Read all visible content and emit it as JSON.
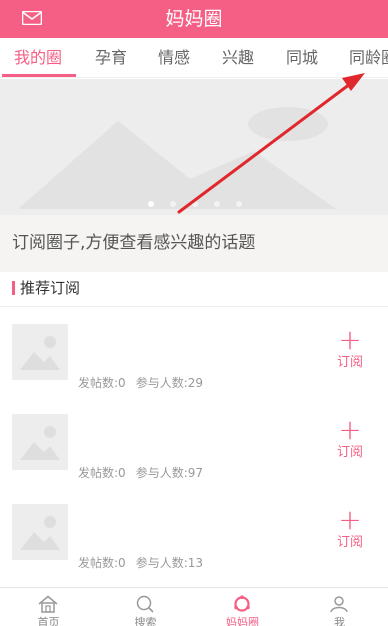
{
  "header": {
    "title": "妈妈圈",
    "mail_icon": "mail-icon",
    "background": "#f55f85"
  },
  "tabs": [
    {
      "label": "我的圈",
      "active": true
    },
    {
      "label": "孕育",
      "active": false
    },
    {
      "label": "情感",
      "active": false
    },
    {
      "label": "兴趣",
      "active": false
    },
    {
      "label": "同城",
      "active": false
    },
    {
      "label": "同龄圈",
      "active": false
    }
  ],
  "banner": {
    "icon": "image-placeholder-icon",
    "page_count": 5,
    "active_index": 0
  },
  "hint": {
    "text": "订阅圈子,方便查看感兴趣的话题"
  },
  "section": {
    "title": "推荐订阅"
  },
  "circles": [
    {
      "thumb_icon": "image-placeholder-icon",
      "posts_label": "发帖数:0",
      "members_label": "参与人数:29",
      "subscribe_label": "订阅",
      "plus": "+"
    },
    {
      "thumb_icon": "image-placeholder-icon",
      "posts_label": "发帖数:0",
      "members_label": "参与人数:97",
      "subscribe_label": "订阅",
      "plus": "+"
    },
    {
      "thumb_icon": "image-placeholder-icon",
      "posts_label": "发帖数:0",
      "members_label": "参与人数:13",
      "subscribe_label": "订阅",
      "plus": "+"
    }
  ],
  "bottom_nav": [
    {
      "label": "首页",
      "icon": "home-icon",
      "active": false
    },
    {
      "label": "搜索",
      "icon": "search-icon",
      "active": false
    },
    {
      "label": "妈妈圈",
      "icon": "circle-icon",
      "active": true
    },
    {
      "label": "我",
      "icon": "user-icon",
      "active": false
    }
  ],
  "colors": {
    "accent": "#f55f85",
    "arrow": "#e0282c"
  }
}
